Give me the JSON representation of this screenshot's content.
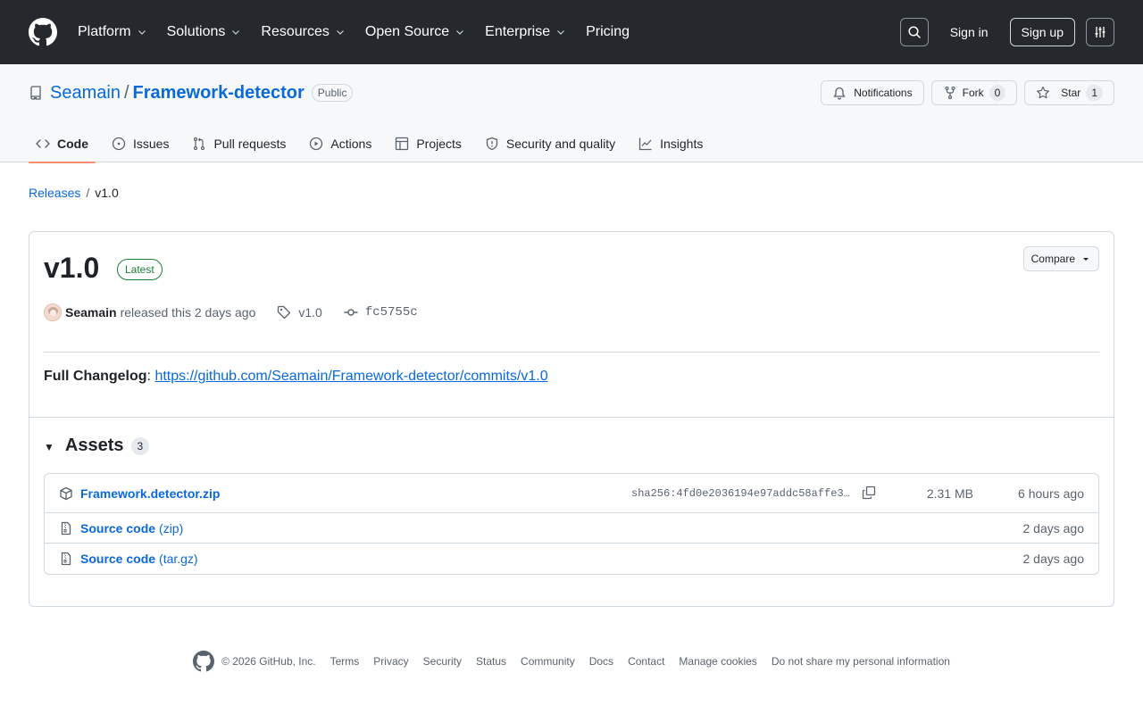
{
  "header": {
    "nav": [
      {
        "label": "Platform"
      },
      {
        "label": "Solutions"
      },
      {
        "label": "Resources"
      },
      {
        "label": "Open Source"
      },
      {
        "label": "Enterprise"
      },
      {
        "label": "Pricing"
      }
    ],
    "signin": "Sign in",
    "signup": "Sign up"
  },
  "repo": {
    "owner": "Seamain",
    "separator": "/",
    "name": "Framework-detector",
    "visibility": "Public",
    "notifications": "Notifications",
    "fork_label": "Fork",
    "fork_count": "0",
    "star_label": "Star",
    "star_count": "1"
  },
  "tabs": [
    {
      "label": "Code",
      "icon": "code-icon",
      "active": true
    },
    {
      "label": "Issues",
      "icon": "issue-opened-icon"
    },
    {
      "label": "Pull requests",
      "icon": "git-pull-request-icon"
    },
    {
      "label": "Actions",
      "icon": "play-icon"
    },
    {
      "label": "Projects",
      "icon": "table-icon"
    },
    {
      "label": "Security and quality",
      "icon": "shield-icon"
    },
    {
      "label": "Insights",
      "icon": "graph-icon"
    }
  ],
  "breadcrumb": {
    "releases": "Releases",
    "sep": "/",
    "current": "v1.0"
  },
  "release": {
    "title": "v1.0",
    "badge": "Latest",
    "compare": "Compare",
    "author": "Seamain",
    "released_text": "released this 2 days ago",
    "tag": "v1.0",
    "commit": "fc5755c",
    "changelog_label": "Full Changelog",
    "changelog_colon": ":",
    "changelog_url": "https://github.com/Seamain/Framework-detector/commits/v1.0"
  },
  "assets": {
    "title": "Assets",
    "count": "3",
    "items": [
      {
        "name": "Framework.detector.zip",
        "sha": "sha256:4fd0e2036194e97addc58affe3…",
        "size": "2.31 MB",
        "time": "6 hours ago"
      },
      {
        "name": "Source code",
        "ext": "(zip)",
        "time": "2 days ago"
      },
      {
        "name": "Source code",
        "ext": "(tar.gz)",
        "time": "2 days ago"
      }
    ]
  },
  "footer": {
    "copyright": "© 2026 GitHub, Inc.",
    "links": [
      "Terms",
      "Privacy",
      "Security",
      "Status",
      "Community",
      "Docs",
      "Contact",
      "Manage cookies",
      "Do not share my personal information"
    ]
  },
  "colors": {
    "header_bg": "#25292e",
    "link": "#0969da",
    "latest_green": "#1a7f37",
    "tab_underline": "#fd8c73"
  }
}
